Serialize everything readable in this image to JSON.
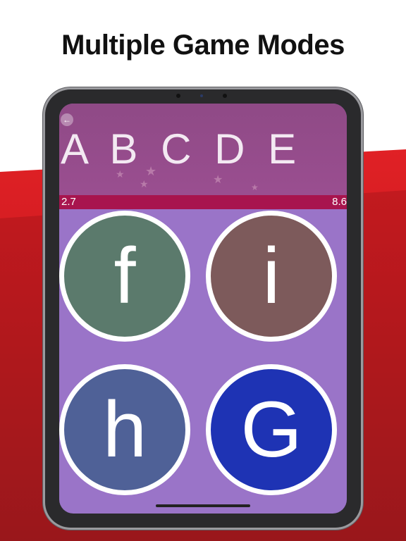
{
  "headline": "Multiple Game Modes",
  "header": {
    "back_icon": "left-arrow-icon",
    "letters": "A B C D E"
  },
  "timer": {
    "left": "2.7",
    "right": "8.6"
  },
  "answers": [
    {
      "letter": "f",
      "color": "#5b7a6c"
    },
    {
      "letter": "i",
      "color": "#7d5a5b"
    },
    {
      "letter": "h",
      "color": "#4f6197"
    },
    {
      "letter": "G",
      "color": "#1e33b4"
    }
  ],
  "colors": {
    "background_red": "#e11f25",
    "screen_bg": "#9a74c8",
    "letters_panel": "#944c8a",
    "timer_bar": "#a8144e"
  }
}
